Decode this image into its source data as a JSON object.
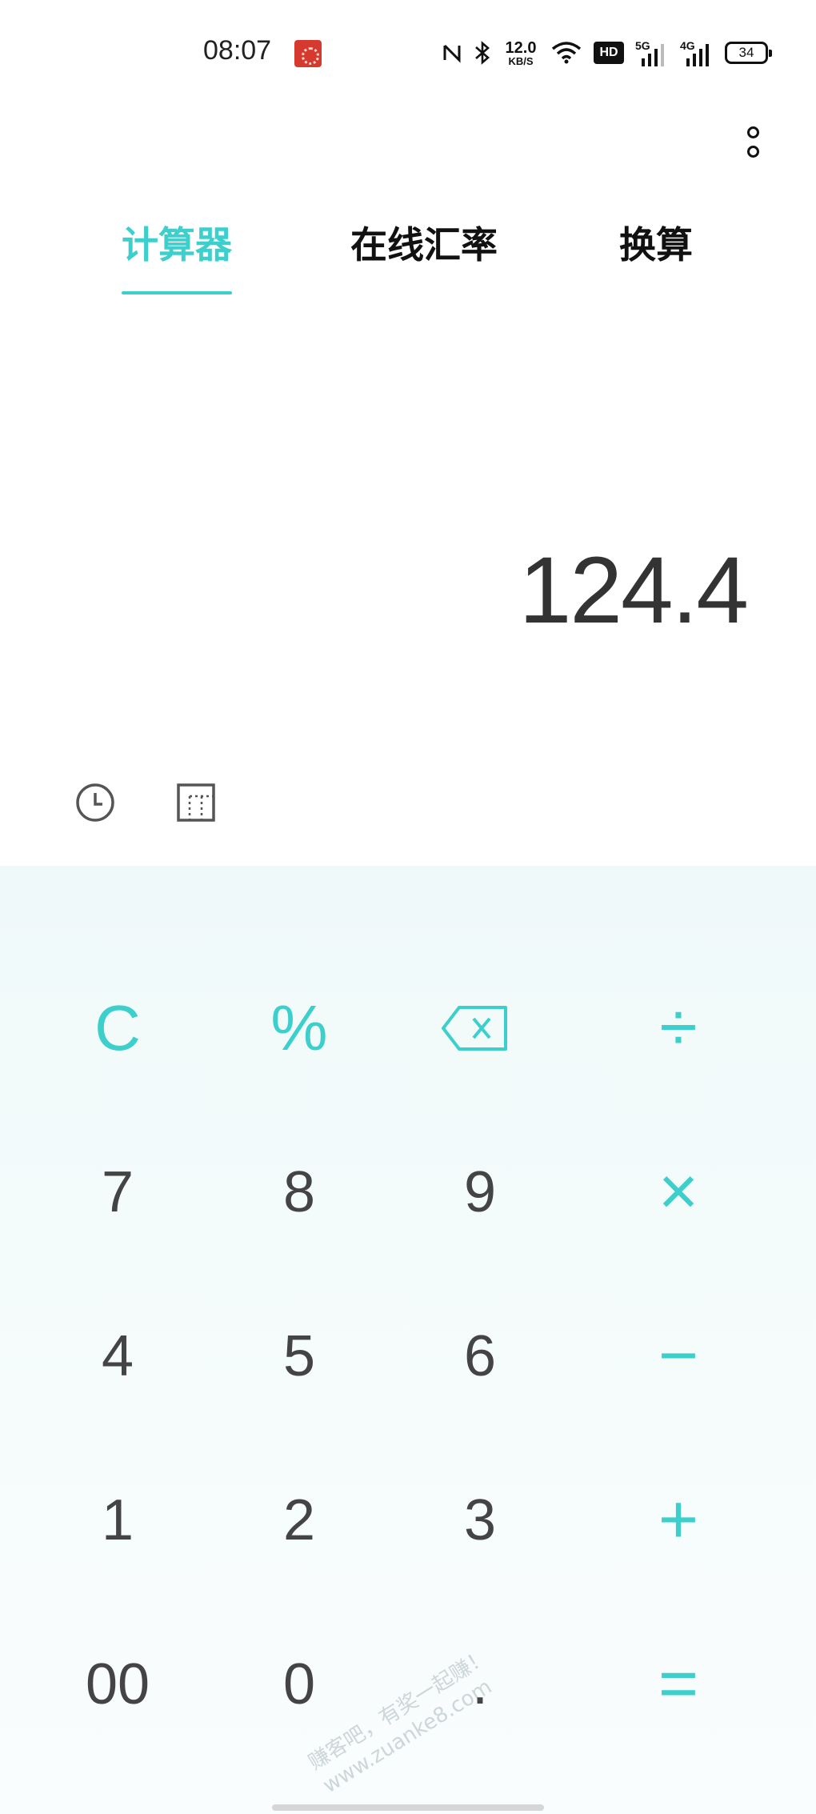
{
  "status_bar": {
    "time": "08:07",
    "net_speed_value": "12.0",
    "net_speed_unit": "KB/S",
    "hd_label": "HD",
    "sig1_label": "5G",
    "sig2_label": "4G",
    "battery": "34",
    "icons": [
      "notification-app-icon",
      "nfc-icon",
      "bluetooth-icon",
      "wifi-icon",
      "hd-voice-icon",
      "signal-5g-icon",
      "signal-4g-icon",
      "battery-icon"
    ]
  },
  "tabs": [
    {
      "label": "计算器",
      "active": true
    },
    {
      "label": "在线汇率",
      "active": false
    },
    {
      "label": "换算",
      "active": false
    }
  ],
  "display": {
    "value": "124.4"
  },
  "tools": [
    "history-icon",
    "scientific-mode-icon"
  ],
  "watermark": {
    "line1": "赚客吧，有奖一起赚！",
    "line2": "www.zuanke8.com"
  },
  "keypad": {
    "rows": [
      [
        "C",
        "%",
        "⌫",
        "÷"
      ],
      [
        "7",
        "8",
        "9",
        "×"
      ],
      [
        "4",
        "5",
        "6",
        "−"
      ],
      [
        "1",
        "2",
        "3",
        "+"
      ],
      [
        "00",
        "0",
        ".",
        "="
      ]
    ]
  },
  "colors": {
    "accent": "#3ccfcc",
    "text": "#333333",
    "keypad_bg": "#f2fafa"
  }
}
